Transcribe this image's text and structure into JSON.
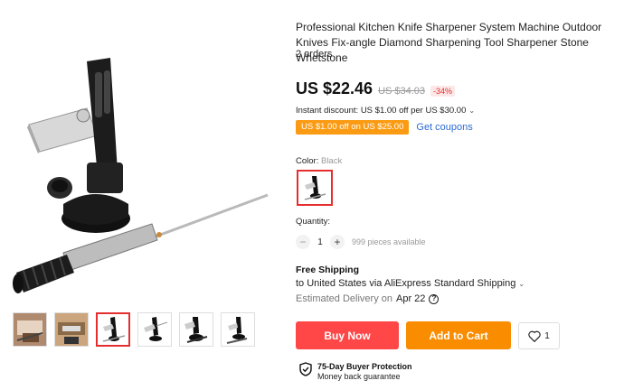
{
  "product": {
    "title": "Professional Kitchen Knife Sharpener System Machine Outdoor Knives Fix-angle Diamond Sharpening Tool Sharpener Stone Whetstone",
    "orders": "2 orders"
  },
  "price": {
    "current": "US $22.46",
    "original": "US $34.03",
    "discount": "-34%"
  },
  "instant_discount": "Instant discount: US $1.00 off per US $30.00",
  "coupon": {
    "badge": "US $1.00 off on US $25.00",
    "link": "Get coupons"
  },
  "color": {
    "label": "Color:",
    "value": "Black"
  },
  "quantity": {
    "label": "Quantity:",
    "value": "1",
    "available": "999 pieces available"
  },
  "shipping": {
    "title": "Free Shipping",
    "to": "to United States via AliExpress Standard Shipping",
    "delivery_label": "Estimated Delivery on",
    "delivery_date": "Apr 22"
  },
  "actions": {
    "buy_now": "Buy Now",
    "add_to_cart": "Add to Cart",
    "wishlist_count": "1"
  },
  "protection": {
    "title": "75-Day Buyer Protection",
    "subtitle": "Money back guarantee"
  },
  "colors": {
    "buy_now": "#ff4747",
    "add_to_cart": "#fa8c00",
    "coupon": "#fa9b13",
    "link": "#2e6bd2",
    "discount": "#e62e2e"
  },
  "icons": [
    "heart-icon",
    "shield-check-icon",
    "help-circle-icon",
    "chevron-down-icon",
    "minus-icon",
    "plus-icon"
  ]
}
